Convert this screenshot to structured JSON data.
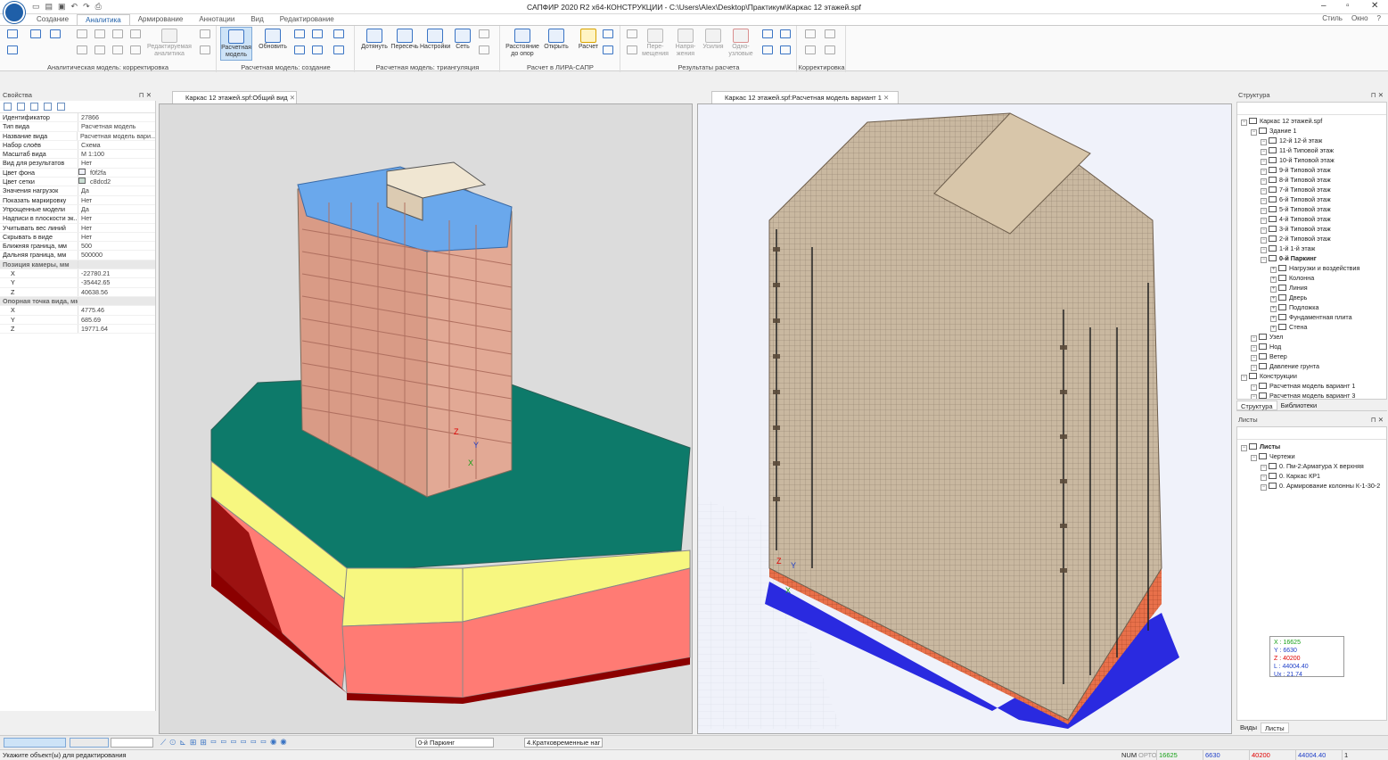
{
  "app": {
    "title": "САПФИР 2020 R2 x64-КОНСТРУКЦИИ - C:\\Users\\Alex\\Desktop\\Практикум\\Каркас 12 этажей.spf"
  },
  "menu": {
    "tabs": [
      "Создание",
      "Аналитика",
      "Армирование",
      "Аннотации",
      "Вид",
      "Редактирование"
    ],
    "active": "Аналитика",
    "right": [
      "Стиль",
      "Окно",
      "?"
    ]
  },
  "ribbon": {
    "groups": [
      "Аналитическая модель: корректировка",
      "Расчетная модель: создание",
      "Расчетная модель: триангуляция",
      "Расчет в ЛИРА-САПР",
      "Результаты расчета",
      "Корректировка"
    ],
    "buttons": {
      "edit_analytics": "Редактируемая аналитика",
      "calc_model": "Расчетная модель",
      "update": "Обновить",
      "extend": "Дотянуть",
      "intersect": "Пересечь",
      "settings": "Настройки",
      "mesh": "Сеть",
      "dist": "Расстояние до опор",
      "open": "Открыть",
      "calc": "Расчет",
      "disp": "Пере-мещения",
      "stress": "Напря-жения",
      "forces": "Усилия",
      "single": "Одно-узловые"
    }
  },
  "properties": {
    "title": "Свойства",
    "rows": [
      {
        "k": "Идентификатор",
        "v": "27866"
      },
      {
        "k": "Тип вида",
        "v": "Расчетная модель"
      },
      {
        "k": "Название вида",
        "v": "Расчетная модель вари..."
      },
      {
        "k": "Набор слоёв",
        "v": "Схема"
      },
      {
        "k": "Масштаб вида",
        "v": "М 1:100"
      },
      {
        "k": "Вид для результатов",
        "v": "Нет"
      },
      {
        "k": "Цвет фона",
        "v": "f0f2fa"
      },
      {
        "k": "Цвет сетки",
        "v": "c8dcd2"
      },
      {
        "k": "Значения нагрузок",
        "v": "Да"
      },
      {
        "k": "Показать маркировку",
        "v": "Нет"
      },
      {
        "k": "Упрощенные модели",
        "v": "Да"
      },
      {
        "k": "Надписи в плоскости эк...",
        "v": "Нет"
      },
      {
        "k": "Учитывать вес линий",
        "v": "Нет"
      },
      {
        "k": "Скрывать в виде",
        "v": "Нет"
      },
      {
        "k": "Ближняя граница, мм",
        "v": "500"
      },
      {
        "k": "Дальняя граница, мм",
        "v": "500000"
      }
    ],
    "camera_title": "Позиция камеры, мм",
    "camera": [
      {
        "k": "X",
        "v": "-22780.21"
      },
      {
        "k": "Y",
        "v": "-35442.65"
      },
      {
        "k": "Z",
        "v": "40638.56"
      }
    ],
    "ref_title": "Опорная точка вида, мм",
    "ref": [
      {
        "k": "X",
        "v": "4775.46"
      },
      {
        "k": "Y",
        "v": "685.69"
      },
      {
        "k": "Z",
        "v": "19771.64"
      }
    ]
  },
  "views": {
    "left_tab": "Каркас 12 этажей.spf:Общий вид",
    "right_tab": "Каркас 12 этажей.spf:Расчетная модель вариант 1"
  },
  "structure": {
    "title": "Структура",
    "items": [
      {
        "label": "Каркас 12 этажей.spf",
        "lvl": 0,
        "bold": false
      },
      {
        "label": "Здание 1",
        "lvl": 1,
        "bold": false
      },
      {
        "label": "12-й 12-й этаж",
        "lvl": 2,
        "bold": false
      },
      {
        "label": "11-й Типовой этаж",
        "lvl": 2,
        "bold": false
      },
      {
        "label": "10-й Типовой этаж",
        "lvl": 2,
        "bold": false
      },
      {
        "label": "9-й Типовой этаж",
        "lvl": 2,
        "bold": false
      },
      {
        "label": "8-й Типовой этаж",
        "lvl": 2,
        "bold": false
      },
      {
        "label": "7-й Типовой этаж",
        "lvl": 2,
        "bold": false
      },
      {
        "label": "6-й Типовой этаж",
        "lvl": 2,
        "bold": false
      },
      {
        "label": "5-й Типовой этаж",
        "lvl": 2,
        "bold": false
      },
      {
        "label": "4-й Типовой этаж",
        "lvl": 2,
        "bold": false
      },
      {
        "label": "3-й Типовой этаж",
        "lvl": 2,
        "bold": false
      },
      {
        "label": "2-й Типовой этаж",
        "lvl": 2,
        "bold": false
      },
      {
        "label": "1-й 1-й этаж",
        "lvl": 2,
        "bold": false
      },
      {
        "label": "0-й Паркинг",
        "lvl": 2,
        "bold": true
      },
      {
        "label": "Нагрузки и воздействия",
        "lvl": 3,
        "bold": false
      },
      {
        "label": "Колонна",
        "lvl": 3,
        "bold": false
      },
      {
        "label": "Линия",
        "lvl": 3,
        "bold": false
      },
      {
        "label": "Дверь",
        "lvl": 3,
        "bold": false
      },
      {
        "label": "Подложка",
        "lvl": 3,
        "bold": false
      },
      {
        "label": "Фундаментная плита",
        "lvl": 3,
        "bold": false
      },
      {
        "label": "Стена",
        "lvl": 3,
        "bold": false
      },
      {
        "label": "Узел",
        "lvl": 1,
        "bold": false
      },
      {
        "label": "Нод",
        "lvl": 1,
        "bold": false
      },
      {
        "label": "Ветер",
        "lvl": 1,
        "bold": false
      },
      {
        "label": "Давление грунта",
        "lvl": 1,
        "bold": false
      },
      {
        "label": "Конструкции",
        "lvl": 0,
        "bold": false
      },
      {
        "label": "Расчетная модель вариант 1",
        "lvl": 1,
        "bold": false
      },
      {
        "label": "Расчетная модель вариант 3",
        "lvl": 1,
        "bold": false
      }
    ],
    "tabs": [
      "Структура",
      "Библиотеки"
    ]
  },
  "sheets": {
    "title": "Листы",
    "items": [
      {
        "label": "Листы",
        "lvl": 0,
        "bold": true
      },
      {
        "label": "Чертежи",
        "lvl": 1,
        "bold": false
      },
      {
        "label": "0. Пм-2:Арматура X верхняя",
        "lvl": 2,
        "bold": false
      },
      {
        "label": "0. Каркас КР1",
        "lvl": 2,
        "bold": false
      },
      {
        "label": "0. Армирование колонны К-1-30-2",
        "lvl": 2,
        "bold": false
      }
    ],
    "tabs": [
      "Виды",
      "Листы"
    ]
  },
  "coords": {
    "x": "X : 16625",
    "y": "Y : 6630",
    "z": "Z : 40200",
    "l": "L : 44004.40",
    "ux": "Ux : 21.74"
  },
  "bottom": {
    "level": "0-й Паркинг",
    "load": "4.Кратковременные наг"
  },
  "status": {
    "hint": "Укажите объект(ы) для редактирования",
    "num": "NUM",
    "orto": "ОРТО",
    "x": "16625",
    "y": "6630",
    "z": "40200",
    "l": "44004.40",
    "n": "1"
  },
  "colors": {
    "accent": "#1f5fa8",
    "selected": "#cde3f7",
    "ground": "#0d7a6a",
    "slab": "#c9b8a0"
  }
}
